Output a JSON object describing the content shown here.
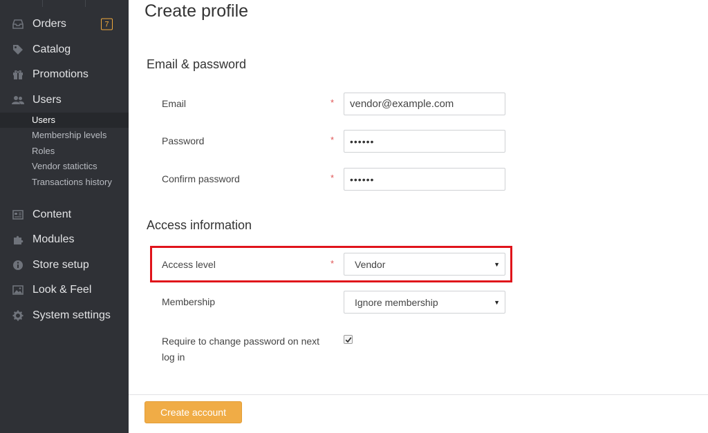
{
  "sidebar": {
    "nav": [
      {
        "label": "Orders",
        "icon": "inbox-icon",
        "badge": "7"
      },
      {
        "label": "Catalog",
        "icon": "tag-icon"
      },
      {
        "label": "Promotions",
        "icon": "gift-icon"
      },
      {
        "label": "Users",
        "icon": "users-icon"
      },
      {
        "label": "Content",
        "icon": "content-icon"
      },
      {
        "label": "Modules",
        "icon": "puzzle-icon"
      },
      {
        "label": "Store setup",
        "icon": "info-icon"
      },
      {
        "label": "Look & Feel",
        "icon": "image-icon"
      },
      {
        "label": "System settings",
        "icon": "gear-icon"
      }
    ],
    "users_sub": [
      {
        "label": "Users",
        "active": true
      },
      {
        "label": "Membership levels"
      },
      {
        "label": "Roles"
      },
      {
        "label": "Vendor statictics"
      },
      {
        "label": "Transactions history"
      }
    ]
  },
  "main": {
    "title": "Create profile",
    "section_email": "Email & password",
    "email_label": "Email",
    "email_value": "vendor@example.com",
    "password_label": "Password",
    "password_value": "••••••",
    "confirm_label": "Confirm password",
    "confirm_value": "••••••",
    "required_mark": "*",
    "section_access": "Access information",
    "access_level_label": "Access level",
    "access_level_value": "Vendor",
    "membership_label": "Membership",
    "membership_value": "Ignore membership",
    "require_change_label": "Require to change password on next log in",
    "require_change_checked": true
  },
  "footer": {
    "create_button": "Create account"
  },
  "colors": {
    "sidebar_bg": "#2f3136",
    "accent": "#f0ac46",
    "badge": "#f0a93c",
    "required": "#e05656",
    "highlight": "#e0141b"
  }
}
